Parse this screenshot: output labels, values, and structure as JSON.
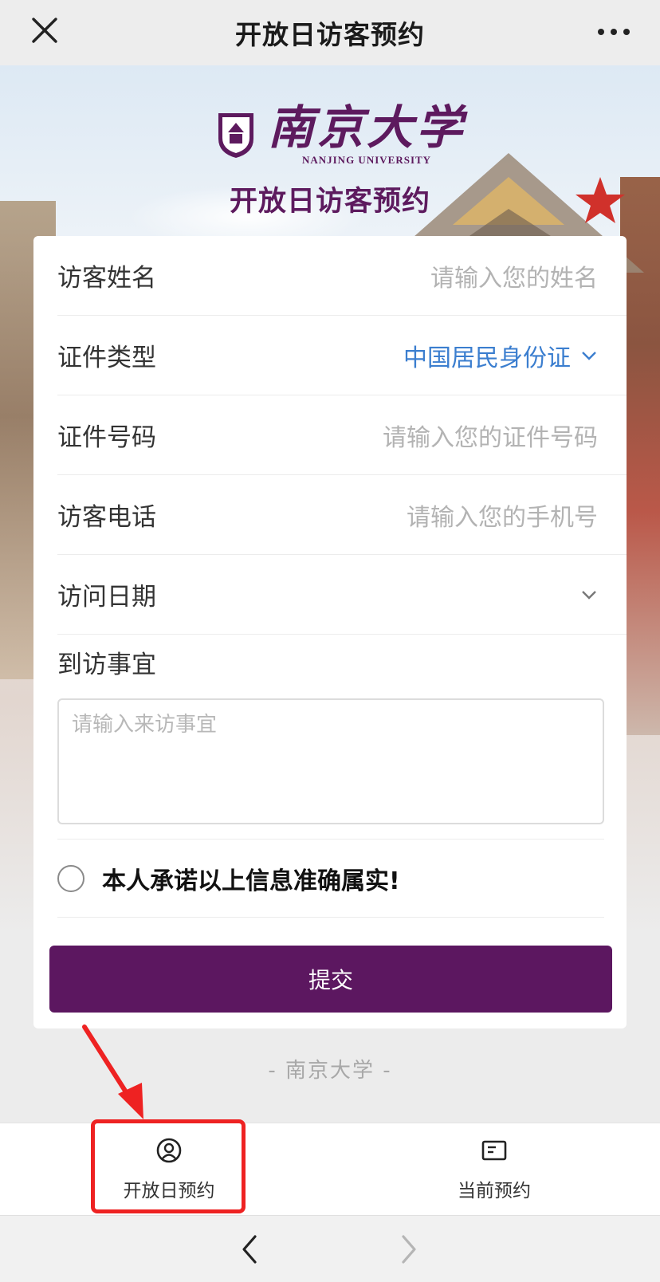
{
  "topbar": {
    "title": "开放日访客预约"
  },
  "brand": {
    "name_cn": "南京大学",
    "name_en": "NANJING UNIVERSITY",
    "page_title": "开放日访客预约"
  },
  "form": {
    "visitor_name": {
      "label": "访客姓名",
      "placeholder": "请输入您的姓名"
    },
    "id_type": {
      "label": "证件类型",
      "value": "中国居民身份证"
    },
    "id_number": {
      "label": "证件号码",
      "placeholder": "请输入您的证件号码"
    },
    "phone": {
      "label": "访客电话",
      "placeholder": "请输入您的手机号"
    },
    "visit_date": {
      "label": "访问日期",
      "value": ""
    },
    "purpose": {
      "label": "到访事宜",
      "placeholder": "请输入来访事宜"
    },
    "promise": {
      "label": "本人承诺以上信息准确属实!",
      "checked": false
    },
    "submit_label": "提交"
  },
  "footer": {
    "brand_text": "-  南京大学  -"
  },
  "tabs": [
    {
      "label": "开放日预约",
      "icon": "user-circle-icon",
      "highlighted": true
    },
    {
      "label": "当前预约",
      "icon": "list-card-icon",
      "highlighted": false
    }
  ],
  "colors": {
    "brand_purple": "#5c1760",
    "link_blue": "#3b7ecf",
    "highlight_red": "#ee2222"
  }
}
